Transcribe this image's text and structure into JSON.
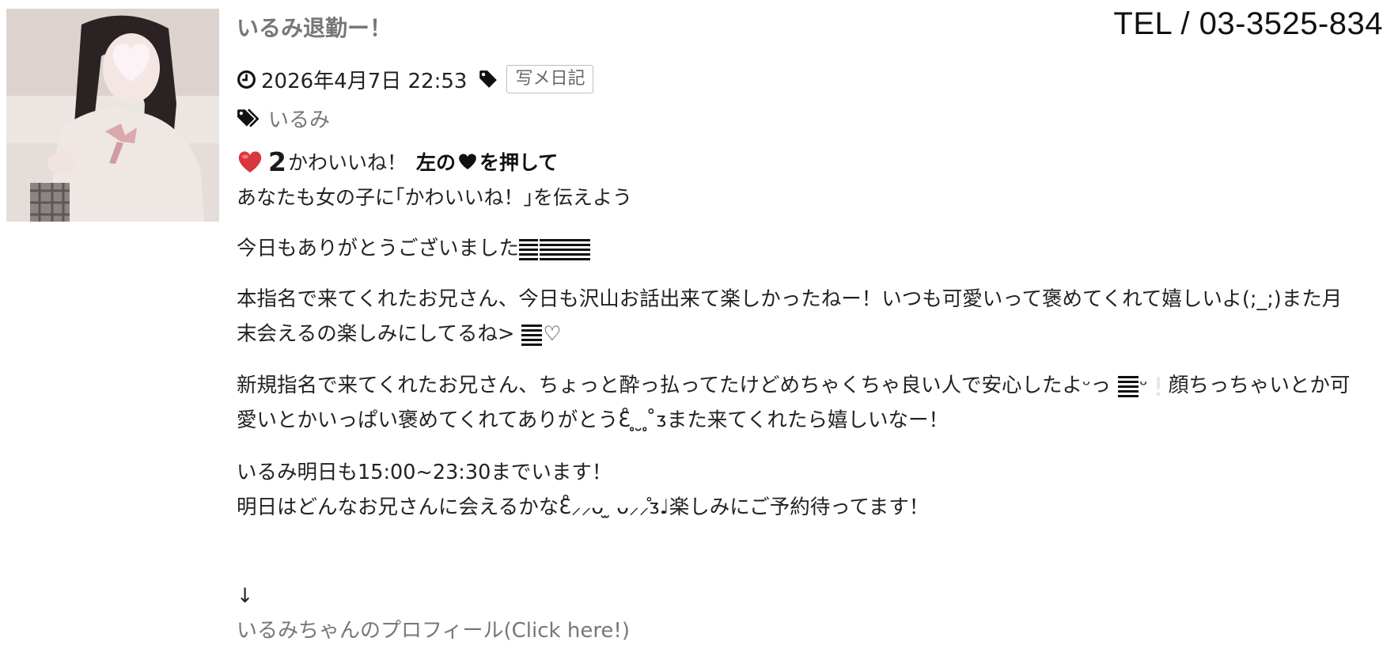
{
  "post": {
    "title": "いるみ退勤ー！",
    "date": "2026年4月7日 22:53",
    "category": "写メ日記",
    "tag": "いるみ"
  },
  "header": {
    "tel": "TEL / 03-3525-834"
  },
  "kawaii": {
    "count": "2",
    "label": "かわいいね！",
    "cta_before": "左の",
    "cta_after": "を押して",
    "sub": "あなたも女の子に｢かわいいね！｣を伝えよう"
  },
  "body": {
    "p1": "今日もありがとうございました",
    "p2a": "本指名で来てくれたお兄さん、今日も沢山お話出来て楽しかったねー！いつも可愛いって褒めてくれて嬉しいよ(;_;)また月",
    "p2b": "末会えるの楽しみにしてるね> ",
    "p2c": "♡",
    "p3a": "新規指名で来てくれたお兄さん、ちょっと酔っ払ってたけどめちゃくちゃ良い人で安心したよᵕっ ",
    "p3b": "ᵕ ",
    "p3c": "顔ちっちゃいとか可",
    "p3d": "愛いとかいっぱい褒めてくれてありがとうƐ̊ ̥ ̮ ̥ ̊ᴣまた来てくれたら嬉しいなー！",
    "p4a": "いるみ明日も15:00~23:30までいます！",
    "p4b": "明日はどんなお兄さんに会えるかなƐ̊⸝⸝ᴗ ̫ ᴗ⸝⸝̊ᴣ♩楽しみにご予約待ってます！",
    "arrow": "↓",
    "profile_link": "いるみちゃんのプロフィール(Click here!)"
  },
  "colors": {
    "title": "#777777",
    "heart": "#d9363e",
    "link": "#777777"
  }
}
